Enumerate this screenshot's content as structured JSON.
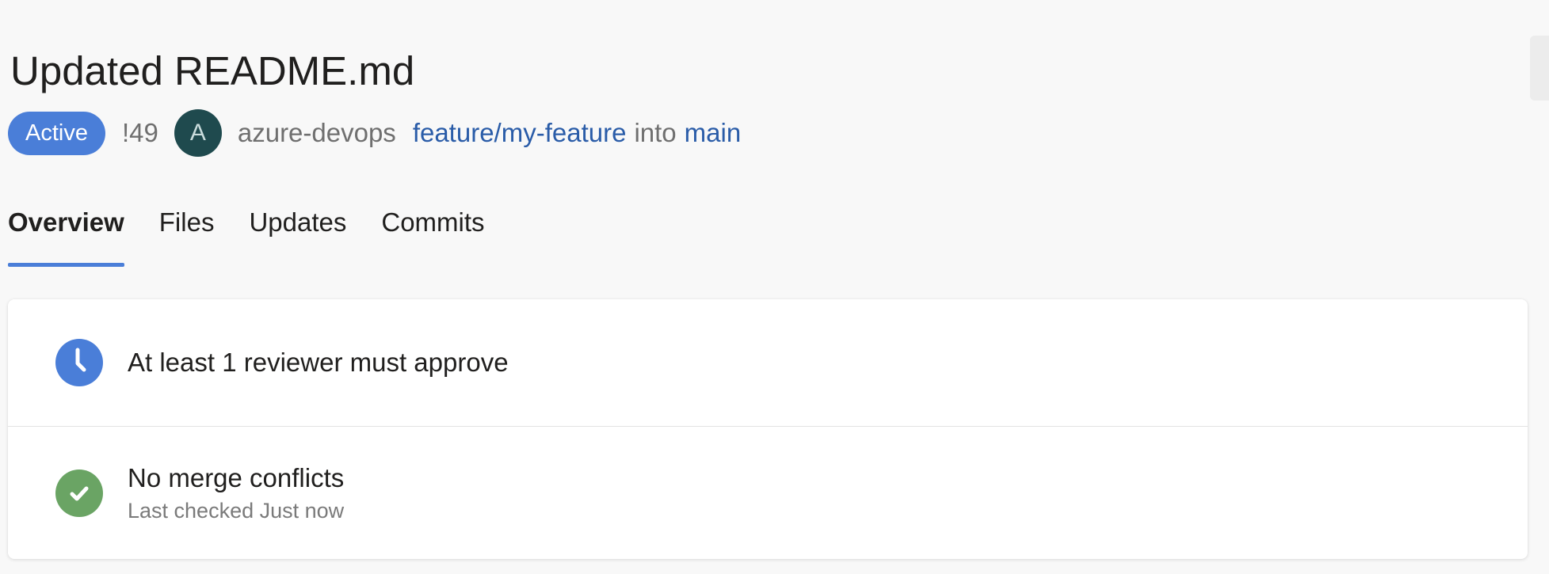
{
  "pr": {
    "title": "Updated README.md",
    "status": "Active",
    "id": "!49",
    "avatar_initial": "A",
    "author": "azure-devops",
    "source_branch": "feature/my-feature",
    "into_text": "into",
    "target_branch": "main"
  },
  "tabs": [
    {
      "label": "Overview",
      "selected": true
    },
    {
      "label": "Files",
      "selected": false
    },
    {
      "label": "Updates",
      "selected": false
    },
    {
      "label": "Commits",
      "selected": false
    }
  ],
  "policies": [
    {
      "icon": "clock-icon",
      "title": "At least 1 reviewer must approve",
      "subtitle": ""
    },
    {
      "icon": "check-circle-icon",
      "title": "No merge conflicts",
      "subtitle": "Last checked Just now"
    }
  ],
  "colors": {
    "accent": "#4a7ed8",
    "success": "#6aa464",
    "link": "#2a5ca8",
    "avatar": "#1f4a4e"
  }
}
